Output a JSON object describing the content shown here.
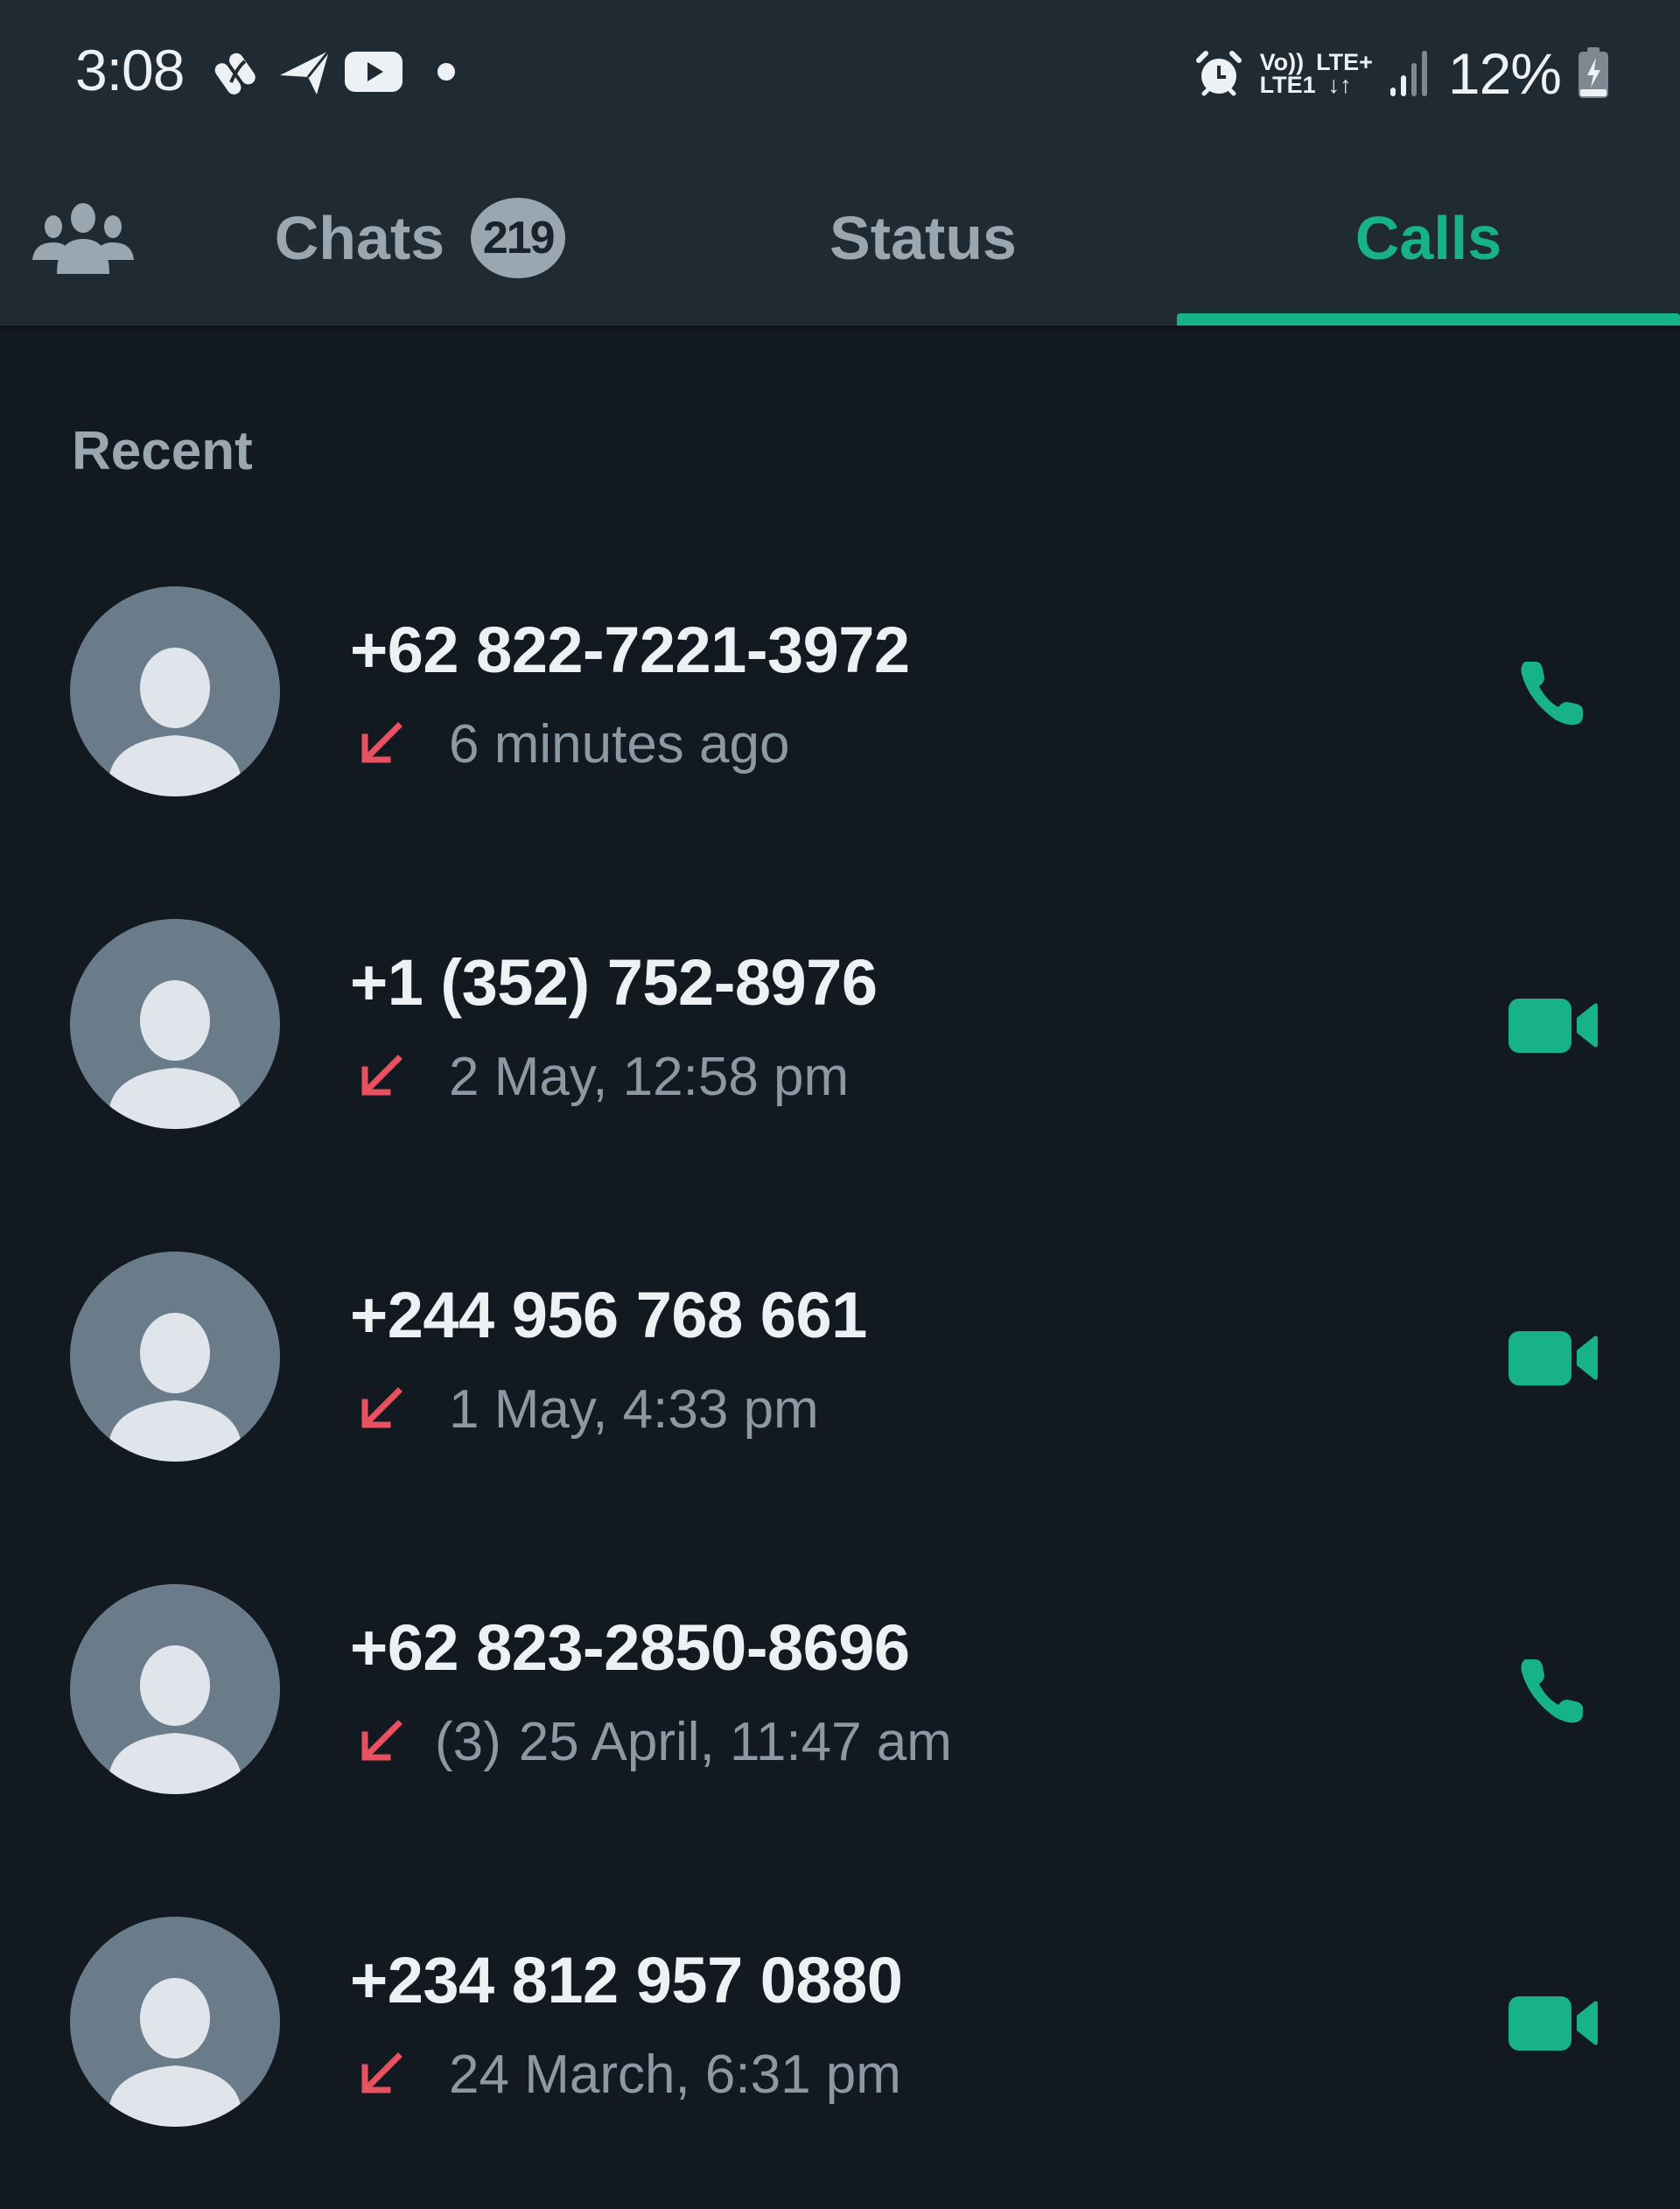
{
  "status_bar": {
    "time": "3:08",
    "left_icons": [
      "app-notification-icon",
      "telegram-icon",
      "youtube-icon",
      "more-notifications-dot-icon"
    ],
    "right": {
      "alarm_icon": "alarm-icon",
      "volte_label": "Vo))",
      "sim_label": "LTE1",
      "network_type": "LTE+",
      "data_arrows": "↓↑",
      "signal_icon": "signal-strength-icon",
      "battery_percent": "12%",
      "battery_icon": "battery-charging-icon"
    }
  },
  "tabs": {
    "community_icon": "communities-icon",
    "items": [
      {
        "label": "Chats",
        "badge": "219",
        "active": false
      },
      {
        "label": "Status",
        "active": false
      },
      {
        "label": "Calls",
        "active": true
      }
    ]
  },
  "section": {
    "label": "Recent"
  },
  "calls": [
    {
      "caller": "+62 822-7221-3972",
      "direction": "missed-incoming",
      "count": "",
      "time": "6 minutes ago",
      "type": "voice",
      "action_icon": "phone-icon"
    },
    {
      "caller": "+1 (352) 752-8976",
      "direction": "missed-incoming",
      "count": "",
      "time": "2 May, 12:58 pm",
      "type": "video",
      "action_icon": "video-camera-icon"
    },
    {
      "caller": "+244 956 768 661",
      "direction": "missed-incoming",
      "count": "",
      "time": "1 May, 4:33 pm",
      "type": "video",
      "action_icon": "video-camera-icon"
    },
    {
      "caller": "+62 823-2850-8696",
      "direction": "missed-incoming",
      "count": "(3)",
      "time": "25 April, 11:47 am",
      "type": "voice",
      "action_icon": "phone-icon"
    },
    {
      "caller": "+234 812 957 0880",
      "direction": "missed-incoming",
      "count": "",
      "time": "24 March, 6:31 pm",
      "type": "video",
      "action_icon": "video-camera-icon"
    }
  ],
  "colors": {
    "accent": "#17b18a",
    "missed": "#e8515f",
    "header_bg": "#1f2a33",
    "content_bg": "#121920",
    "avatar_bg": "#6a7c89",
    "avatar_fg": "#dfe5ea"
  }
}
